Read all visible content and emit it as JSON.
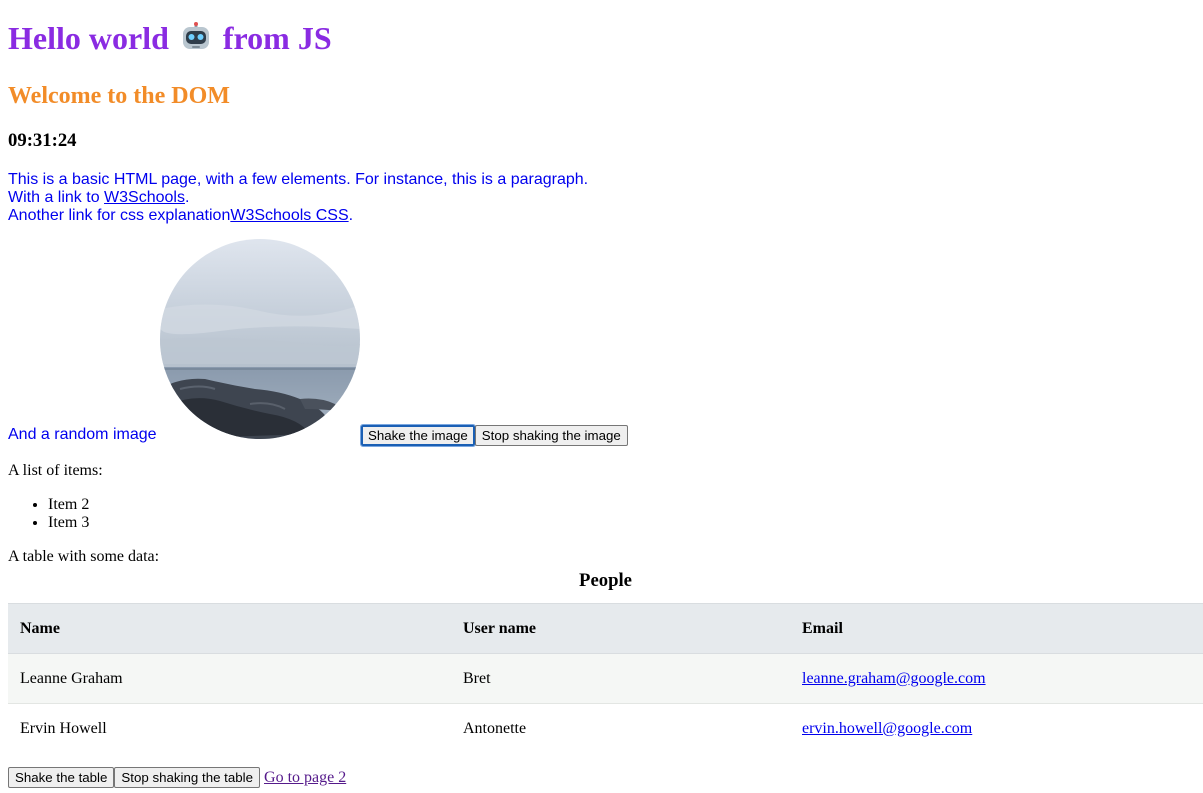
{
  "heading": {
    "part1": "Hello world",
    "robot_icon": "robot-emoji",
    "part2": "from JS",
    "color": "#8a2be2"
  },
  "subheading": {
    "text": "Welcome to the DOM",
    "color": "#f28c28"
  },
  "clock": "09:31:24",
  "intro": {
    "line1": "This is a basic HTML page, with a few elements. For instance, this is a paragraph.",
    "line2_prefix": "With a link to ",
    "line2_link": "W3Schools",
    "line2_suffix": ".",
    "line3_prefix": "Another link for css explanation",
    "line3_link": "W3Schools CSS",
    "line3_suffix": "."
  },
  "image_section": {
    "caption": "And a random image",
    "shake_label": "Shake the image",
    "stop_label": "Stop shaking the image"
  },
  "list": {
    "label": "A list of items:",
    "items": [
      "Item 2",
      "Item 3"
    ]
  },
  "table": {
    "label": "A table with some data:",
    "caption": "People",
    "headers": [
      "Name",
      "User name",
      "Email"
    ],
    "rows": [
      [
        "Leanne Graham",
        "Bret",
        "leanne.graham@google.com"
      ],
      [
        "Ervin Howell",
        "Antonette",
        "ervin.howell@google.com"
      ]
    ]
  },
  "bottom": {
    "shake_label": "Shake the table",
    "stop_label": "Stop shaking the table",
    "link": "Go to page 2"
  }
}
